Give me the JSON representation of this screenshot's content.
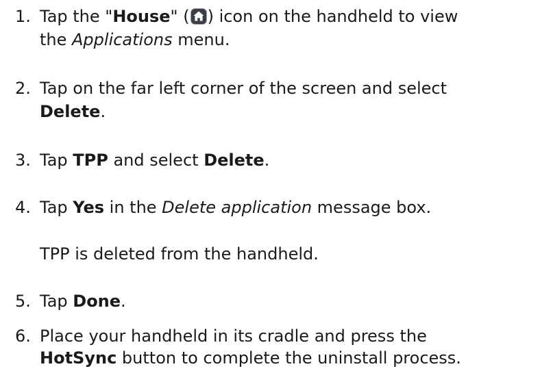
{
  "steps": [
    {
      "number": "1.",
      "line1": {
        "a": "Tap the \"",
        "b": "House",
        "c": "\" (",
        "d": ") icon on the handheld to view"
      },
      "line2": {
        "a": "the ",
        "b": "Applications",
        "c": " menu."
      },
      "icon": "house-icon"
    },
    {
      "number": "2.",
      "line1": "Tap on the far left corner of the screen and select",
      "line2": {
        "a": "Delete",
        "b": "."
      }
    },
    {
      "number": "3.",
      "a": "Tap ",
      "b": "TPP",
      "c": " and select ",
      "d": "Delete",
      "e": "."
    },
    {
      "number": "4.",
      "a": "Tap ",
      "b": "Yes",
      "c": " in the ",
      "d": "Delete application",
      "e": " message box."
    },
    {
      "number": "5.",
      "a": "Tap ",
      "b": "Done",
      "c": "."
    },
    {
      "number": "6.",
      "line1": "Place your handheld in its cradle and press the",
      "line2": {
        "a": "HotSync",
        "b": " button to complete the uninstall process."
      }
    }
  ],
  "note": "TPP is deleted from the handheld.",
  "colors": {
    "text": "#1a1a1a",
    "icon_bg": "#3a3f45",
    "icon_fg": "#ffffff"
  }
}
